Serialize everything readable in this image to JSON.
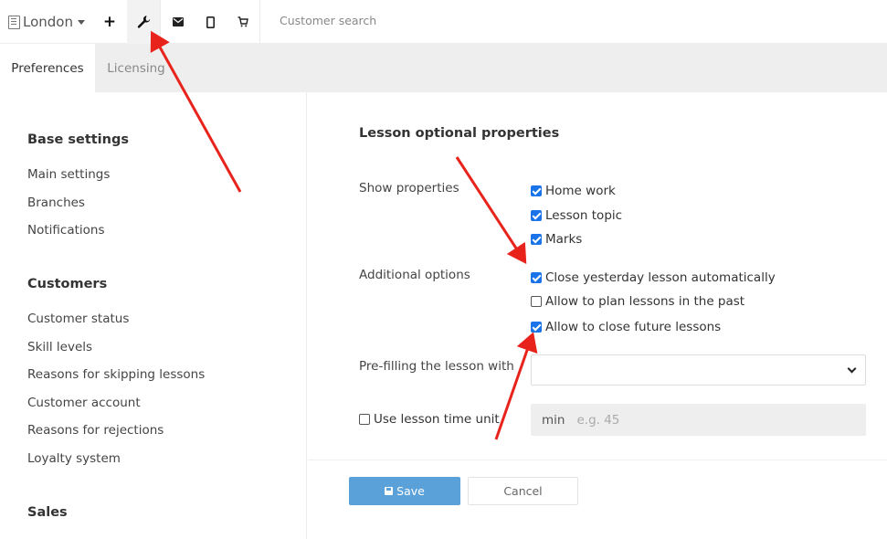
{
  "header": {
    "branch": "London",
    "search_placeholder": "Customer search"
  },
  "tabs": [
    {
      "label": "Preferences",
      "active": true
    },
    {
      "label": "Licensing",
      "active": false
    }
  ],
  "sidebar": {
    "sections": [
      {
        "title": "Base settings",
        "items": [
          "Main settings",
          "Branches",
          "Notifications"
        ]
      },
      {
        "title": "Customers",
        "items": [
          "Customer status",
          "Skill levels",
          "Reasons for skipping lessons",
          "Customer account",
          "Reasons for rejections",
          "Loyalty system"
        ]
      },
      {
        "title": "Sales",
        "items": []
      }
    ]
  },
  "panel": {
    "title": "Lesson optional properties",
    "show_properties": {
      "label": "Show properties",
      "options": [
        {
          "label": "Home work",
          "checked": true
        },
        {
          "label": "Lesson topic",
          "checked": true
        },
        {
          "label": "Marks",
          "checked": true
        }
      ]
    },
    "additional_options": {
      "label": "Additional options",
      "options": [
        {
          "label": "Close yesterday lesson automatically",
          "checked": true
        },
        {
          "label": "Allow to plan lessons in the past",
          "checked": false
        },
        {
          "label": "Allow to close future lessons",
          "checked": true
        }
      ]
    },
    "prefill": {
      "label": "Pre-filling the lesson with",
      "value": ""
    },
    "time_unit": {
      "label": "Use lesson time unit",
      "checked": false,
      "unit": "min",
      "placeholder": "e.g. 45"
    }
  },
  "actions": {
    "save": "Save",
    "cancel": "Cancel"
  },
  "colors": {
    "accent": "#5aa1d9",
    "checkbox": "#1a73e8",
    "annotation_arrow": "#e8231c"
  }
}
